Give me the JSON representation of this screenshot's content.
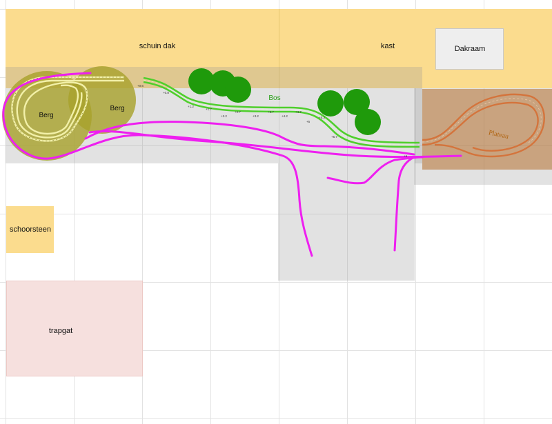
{
  "zones": {
    "roof": "schuin dak",
    "cabinet": "kast",
    "skylight": "Dakraam",
    "chimney": "schoorsteen",
    "stairwell": "trapgat",
    "plateau": "Plateau",
    "forest": "Bos",
    "mountain_left": "Berg",
    "mountain_right": "Berg"
  },
  "colors": {
    "roof_fill": "#fbdc8e",
    "board_fill": "#c8c8c8",
    "plateau_fill": "#c8904f",
    "forest_tree": "#1f9a0b",
    "mountain_fill": "#a7a12a",
    "green_track": "#4fcf2c",
    "planned_track": "#ee1ff0",
    "plateau_track": "#d4743c",
    "stairwell_fill": "#f6e0de",
    "forest_label": "#29a01a",
    "plateau_label": "#b0630f"
  },
  "height_marks": [
    "+0.6",
    "+0.8",
    "+1.2",
    "+1.7",
    "+2.2",
    "+2.7",
    "+3.2",
    "+3.7",
    "+4.2",
    "+4.7",
    "+5",
    "+5.3",
    "+5.7",
    "+6",
    "+6.3",
    "+6.7",
    "+7",
    "+7.3"
  ]
}
